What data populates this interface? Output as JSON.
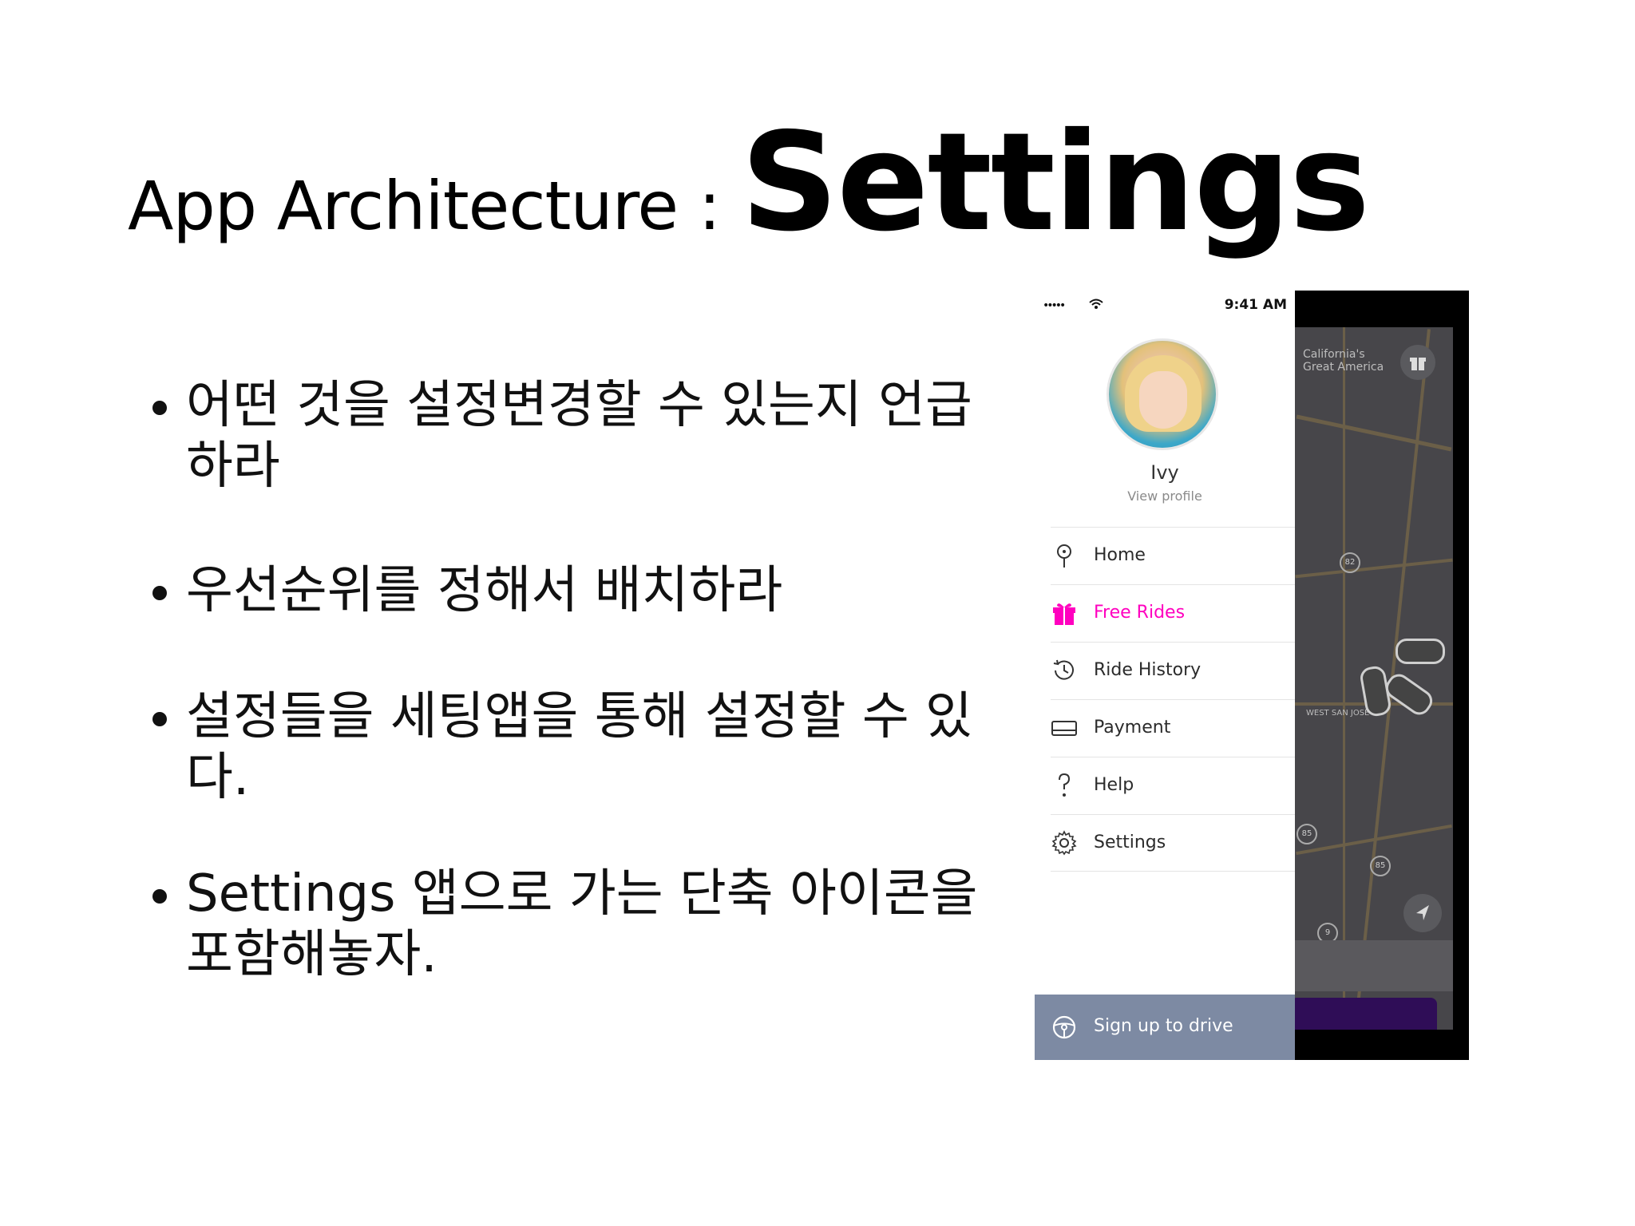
{
  "slide": {
    "title_prefix": "App Architecture : ",
    "title_main": "Settings",
    "bullets": [
      "어떤 것을 설정변경할 수 있는지 언급하라",
      "우선순위를 정해서 배치하라",
      "설정들을 세팅앱을 통해 설정할 수 있다.",
      "Settings 앱으로 가는 단축 아이콘을 포함해놓자."
    ]
  },
  "phone": {
    "status_bar": {
      "signal": "•••••",
      "time": "9:41 AM"
    },
    "profile": {
      "name": "Ivy",
      "link": "View profile"
    },
    "menu": [
      {
        "label": "Home",
        "icon": "location-pin-icon"
      },
      {
        "label": "Free Rides",
        "icon": "gift-icon",
        "accent": "#ff00bf"
      },
      {
        "label": "Ride History",
        "icon": "history-clock-icon"
      },
      {
        "label": "Payment",
        "icon": "credit-card-icon"
      },
      {
        "label": "Help",
        "icon": "help-question-icon"
      },
      {
        "label": "Settings",
        "icon": "gear-icon"
      }
    ],
    "drive_bar": {
      "label": "Sign up to drive",
      "icon": "steering-wheel-icon",
      "color": "#7d8aa3"
    },
    "map": {
      "labels": [
        "California's",
        "Great America",
        "WEST SAN JOSE"
      ],
      "route_markers": [
        "82",
        "85",
        "85",
        "9"
      ]
    }
  },
  "colors": {
    "accent": "#ff00bf",
    "cta_purple": "#2f0d57",
    "map_bg": "#47464a"
  }
}
